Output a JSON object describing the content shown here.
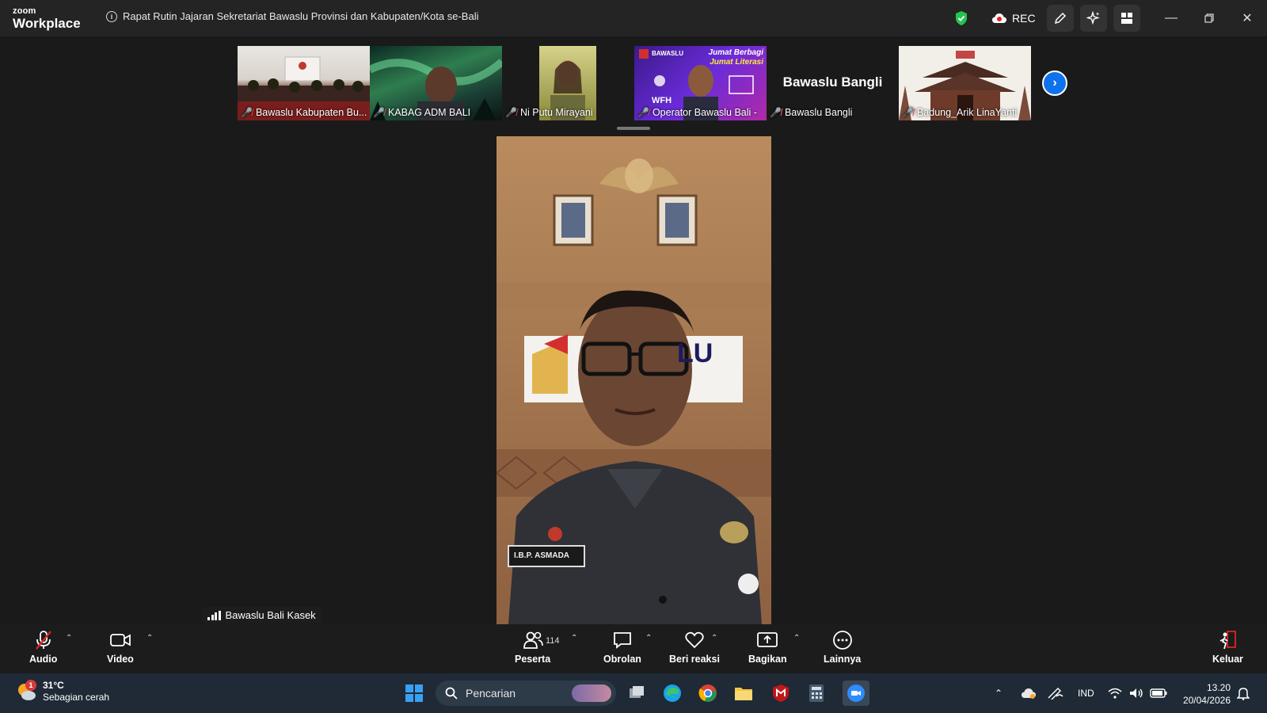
{
  "app": {
    "logo_small": "zoom",
    "logo_big": "Workplace",
    "meeting_title": "Rapat Rutin Jajaran Sekretariat Bawaslu Provinsi dan Kabupaten/Kota se-Bali",
    "rec_label": "REC"
  },
  "thumbnails": [
    {
      "name": "Bawaslu Kabupaten Bu...",
      "muted": true,
      "scene": "room"
    },
    {
      "name": "KABAG ADM BALI",
      "muted": true,
      "scene": "aurora"
    },
    {
      "name": "Ni Putu Mirayani",
      "muted": true,
      "scene": "person"
    },
    {
      "name": "Operator Bawaslu Bali -",
      "muted": true,
      "scene": "banner"
    },
    {
      "name": "Bawaslu Bangli",
      "muted": true,
      "scene": "name-only",
      "display_name": "Bawaslu Bangli"
    },
    {
      "name": "Badung_Arik LinaYanti",
      "muted": true,
      "scene": "temple"
    }
  ],
  "banner_text": {
    "line1": "Jumat Berbagi",
    "line2": "Jumat Literasi",
    "wfh": "WFH",
    "logo": "BAWASLU"
  },
  "main_video": {
    "speaker_label": "Bawaslu Bali Kasek",
    "wall_text": "LU",
    "name_tag": "I.B.P. ASMADA"
  },
  "controls": {
    "audio": "Audio",
    "video": "Video",
    "participants": "Peserta",
    "participants_count": "114",
    "chat": "Obrolan",
    "react": "Beri reaksi",
    "share": "Bagikan",
    "more": "Lainnya",
    "leave": "Keluar"
  },
  "taskbar": {
    "weather_temp": "31°C",
    "weather_desc": "Sebagian cerah",
    "weather_badge": "1",
    "search_placeholder": "Pencarian",
    "language": "IND",
    "time": "13.20",
    "date": "20/04/2026"
  },
  "colors": {
    "accent_blue": "#0e72ed",
    "mute_red": "#ff4d4d",
    "shield_green": "#23c552",
    "taskbar_bg": "#1f2a36"
  }
}
